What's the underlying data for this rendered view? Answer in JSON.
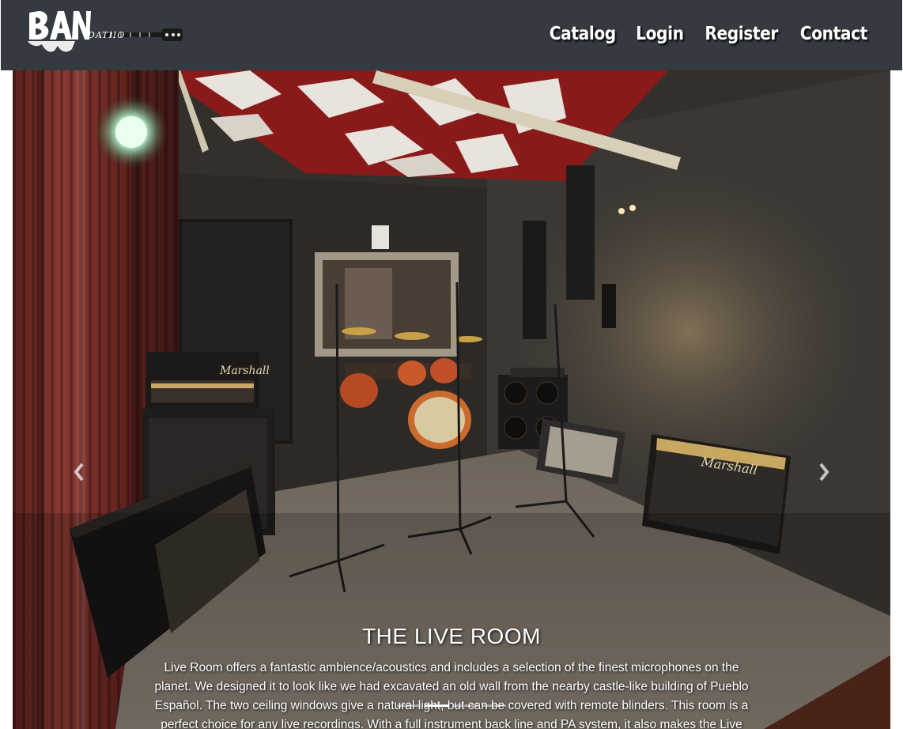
{
  "brand": {
    "logo_text": "BAN",
    "logo_suffix": "DATIIO",
    "icon": "band-logo-icon"
  },
  "nav": {
    "items": [
      {
        "label": "Catalog"
      },
      {
        "label": "Login"
      },
      {
        "label": "Register"
      },
      {
        "label": "Contact"
      }
    ]
  },
  "carousel": {
    "image_icon": "live-room-photo",
    "prev_icon": "chevron-left-icon",
    "next_icon": "chevron-right-icon",
    "caption": {
      "title": "THE LIVE ROOM",
      "text": "Live Room offers a fantastic ambience/acoustics and includes a selection of the finest microphones on the planet. We designed it to look like we had excavated an old wall from the nearby castle-like building of Pueblo Español. The two ceiling windows give a natural light, but can be covered with remote blinders. This room is a perfect choice for any live recordings. With a full instrument back line and PA system, it also makes the Live Room a perfect place for intimate show-cases."
    },
    "indicators": {
      "count": 4,
      "active_index": 1
    }
  },
  "colors": {
    "navbar": "#343a40",
    "nav_text": "#ffffff",
    "caption_text": "#ffffff"
  }
}
